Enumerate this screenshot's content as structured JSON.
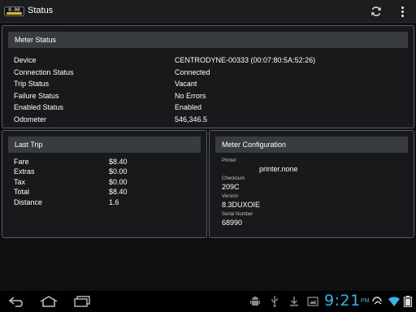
{
  "app": {
    "icon_text": "0.00",
    "title": "Status",
    "actions": {
      "refresh_icon": "refresh-icon",
      "overflow_icon": "overflow-menu-icon"
    }
  },
  "meter_status": {
    "header": "Meter Status",
    "rows": [
      {
        "label": "Device",
        "value": "CENTRODYNE-00333 (00:07:80:5A:52:26)"
      },
      {
        "label": "Connection Status",
        "value": "Connected"
      },
      {
        "label": "Trip Status",
        "value": "Vacant"
      },
      {
        "label": "Failure Status",
        "value": "No Errors"
      },
      {
        "label": "Enabled Status",
        "value": "Enabled"
      },
      {
        "label": "Odometer",
        "value": "546,346.5"
      }
    ]
  },
  "last_trip": {
    "header": "Last Trip",
    "rows": [
      {
        "label": "Fare",
        "value": "$8.40"
      },
      {
        "label": "Extras",
        "value": "$0.00"
      },
      {
        "label": "Tax",
        "value": "$0.00"
      },
      {
        "label": "Total",
        "value": "$8.40"
      },
      {
        "label": "Distance",
        "value": "1.6"
      }
    ]
  },
  "meter_configuration": {
    "header": "Meter Configuration",
    "printer_label": "Printer",
    "printer_value": "printer.none",
    "checksum_label": "Checksum",
    "checksum_value": "209C",
    "version_label": "Version",
    "version_value": "8.3DUXOIE",
    "serial_label": "Serial Number",
    "serial_value": "68990"
  },
  "system_bar": {
    "time": "9:21",
    "ampm": "PM"
  },
  "colors": {
    "clock": "#33b5e5",
    "panel_header": "#393c3f",
    "panel_border": "#5a5d60",
    "icon_lamp": "#e0b62a"
  }
}
